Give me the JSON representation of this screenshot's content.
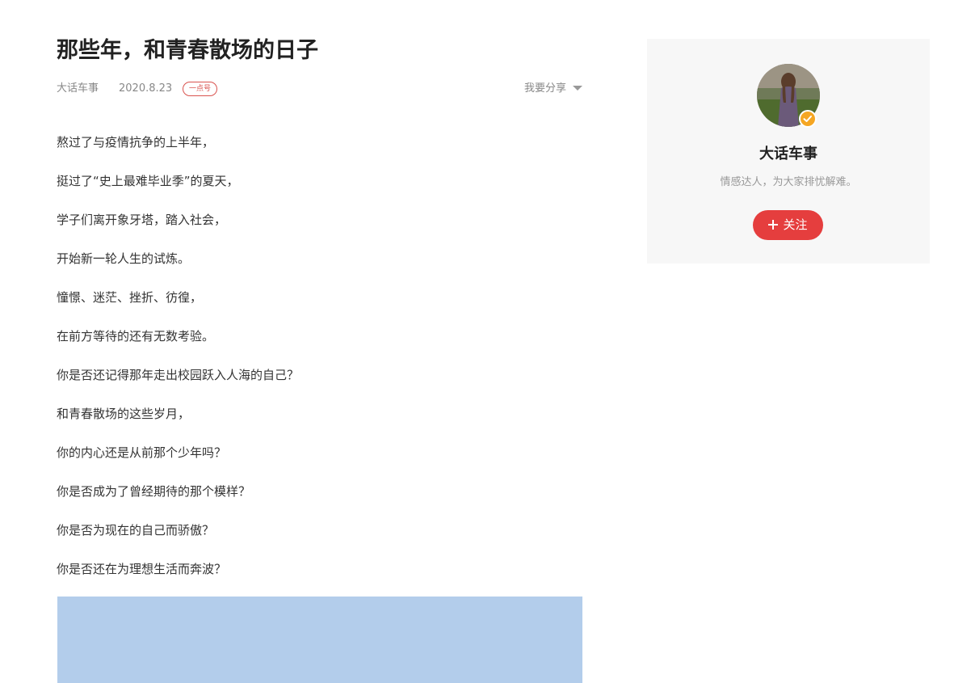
{
  "article": {
    "title": "那些年，和青春散场的日子",
    "author": "大话车事",
    "date": "2020.8.23",
    "badge": "一点号",
    "share_label": "我要分享",
    "paragraphs": [
      "熬过了与疫情抗争的上半年，",
      "挺过了“史上最难毕业季”的夏天，",
      "学子们离开象牙塔，踏入社会，",
      "开始新一轮人生的试炼。",
      "憧憬、迷茫、挫折、彷徨，",
      "在前方等待的还有无数考验。",
      "你是否还记得那年走出校园跃入人海的自己？",
      "和青春散场的这些岁月，",
      "你的内心还是从前那个少年吗？",
      "你是否成为了曾经期待的那个模样？",
      "你是否为现在的自己而骄傲？",
      "你是否还在为理想生活而奔波？"
    ]
  },
  "sidebar": {
    "name": "大话车事",
    "description": "情感达人，为大家排忧解难。",
    "follow_label": "关注",
    "avatar_icon": "user-avatar-icon",
    "verified_icon": "verified-check-icon"
  },
  "colors": {
    "accent": "#e53e3e",
    "verified": "#f5a623",
    "image_placeholder": "#b3cdeb"
  }
}
